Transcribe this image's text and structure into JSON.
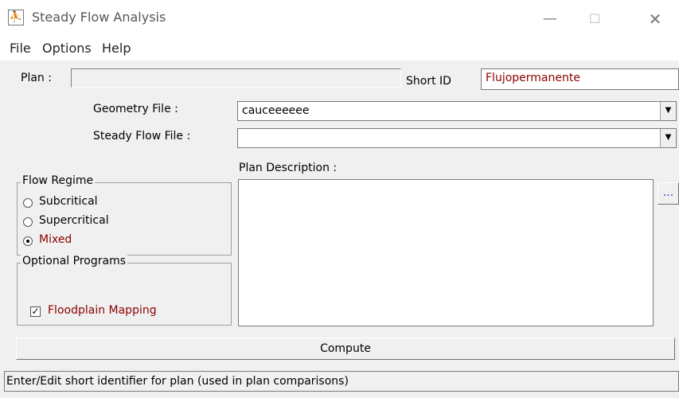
{
  "window": {
    "title": "Steady Flow Analysis",
    "controls": {
      "minimize": "—",
      "maximize": "☐",
      "close": "✕"
    }
  },
  "menu": [
    "File",
    "Options",
    "Help"
  ],
  "plan": {
    "label": "Plan :",
    "value": "",
    "short_id_label": "Short ID",
    "short_id_value": "Flujopermanente"
  },
  "geometry": {
    "label": "Geometry File :",
    "value": "cauceeeeee"
  },
  "steady_flow": {
    "label": "Steady Flow File :",
    "value": ""
  },
  "flow_regime": {
    "label": "Flow Regime",
    "options": [
      {
        "label": "Subcritical",
        "selected": false
      },
      {
        "label": "Supercritical",
        "selected": false
      },
      {
        "label": "Mixed",
        "selected": true
      }
    ]
  },
  "optional_programs": {
    "label": "Optional Programs",
    "floodplain_label": "Floodplain Mapping",
    "floodplain_checked": true
  },
  "description": {
    "label": "Plan Description :",
    "value": "",
    "ellipsis": "..."
  },
  "compute_label": "Compute",
  "status": "Enter/Edit short identifier for plan (used in plan comparisons)"
}
